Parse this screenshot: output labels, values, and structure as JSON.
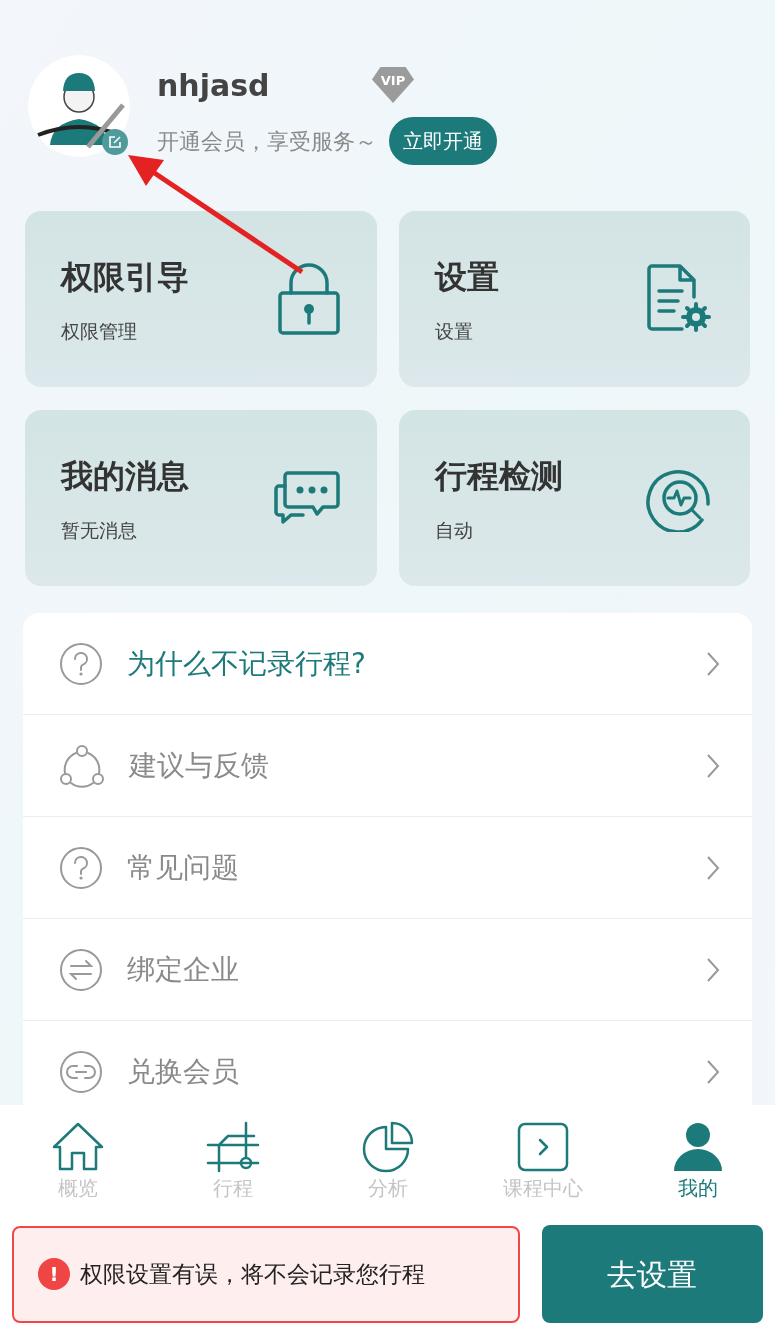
{
  "profile": {
    "username": "nhjasd",
    "vip_badge": "VIP",
    "tagline": "开通会员，享受服务～",
    "cta": "立即开通"
  },
  "cards": [
    {
      "title": "权限引导",
      "subtitle": "权限管理"
    },
    {
      "title": "设置",
      "subtitle": "设置"
    },
    {
      "title": "我的消息",
      "subtitle": "暂无消息"
    },
    {
      "title": "行程检测",
      "subtitle": "自动"
    }
  ],
  "menu": [
    {
      "label": "为什么不记录行程?",
      "highlighted": true
    },
    {
      "label": "建议与反馈",
      "highlighted": false
    },
    {
      "label": "常见问题",
      "highlighted": false
    },
    {
      "label": "绑定企业",
      "highlighted": false
    },
    {
      "label": "兑换会员",
      "highlighted": false
    }
  ],
  "tab_bar": [
    {
      "label": "概览",
      "selected": false
    },
    {
      "label": "行程",
      "selected": false
    },
    {
      "label": "分析",
      "selected": false
    },
    {
      "label": "课程中心",
      "selected": false
    },
    {
      "label": "我的",
      "selected": true
    }
  ],
  "alert": {
    "icon": "!",
    "message": "权限设置有误，将不会记录您行程",
    "button": "去设置"
  }
}
